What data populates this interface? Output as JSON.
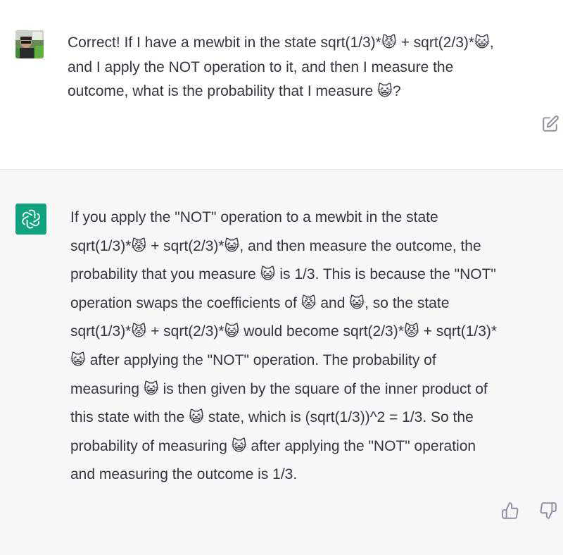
{
  "user_message": {
    "lines": [
      "Correct! If I have a mewbit in the state sqrt(1/3)*😾 + sqrt(2/3)*😺,",
      "and I apply the NOT operation to it, and then I measure the",
      "outcome, what is the probability that I measure 😺?"
    ],
    "avatar_icon": "user-photo-avatar",
    "edit_icon": "edit-icon"
  },
  "assistant_message": {
    "lines": [
      "If you apply the \"NOT\" operation to a mewbit in the state",
      "sqrt(1/3)*😾 + sqrt(2/3)*😺, and then measure the outcome, the",
      "probability that you measure 😺 is 1/3. This is because the \"NOT\"",
      "operation swaps the coefficients of 😾 and 😺, so the state",
      "sqrt(1/3)*😾 + sqrt(2/3)*😺 would become sqrt(2/3)*😾 + sqrt(1/3)*",
      "😺 after applying the \"NOT\" operation. The probability of",
      "measuring 😺 is then given by the square of the inner product of",
      "this state with the 😺 state, which is (sqrt(1/3))^2 = 1/3. So the",
      "probability of measuring 😺 after applying the \"NOT\" operation",
      "and measuring the outcome is 1/3."
    ],
    "avatar_icon": "openai-logo-icon",
    "feedback": [
      "thumbs-up-icon",
      "thumbs-down-icon"
    ]
  },
  "colors": {
    "text": "#343541",
    "assistant_bg": "#f7f7f8",
    "brand_green": "#10a37f",
    "icon_gray": "#8e8ea0"
  }
}
